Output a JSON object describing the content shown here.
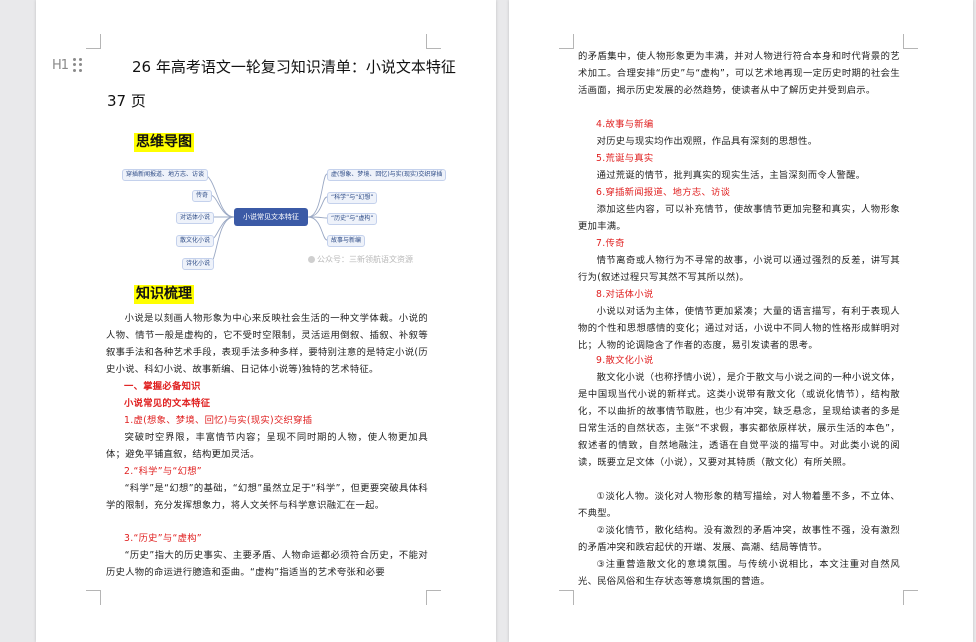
{
  "left_page": {
    "heading_tag": "H1",
    "title": "26 年高考语文一轮复习知识清单：小说文本特征",
    "title_line2": "37 页",
    "mindmap_heading": "思维导图",
    "knowledge_heading": "知识梳理",
    "mindmap": {
      "center": "小说常见文本特征",
      "left_nodes": [
        "穿插新闻报道、地方志、访谈",
        "传奇",
        "对话体小说",
        "散文化小说",
        "诗化小说"
      ],
      "right_nodes": [
        "虚(想象、梦境、回忆)与实(现实)交织穿插",
        "“科学”与“幻想”",
        "“历史”与“虚构”",
        "故事与新编"
      ],
      "watermark": "公众号：三新领航语文资源"
    },
    "paragraphs": {
      "intro": "小说是以刻画人物形象为中心来反映社会生活的一种文学体裁。小说的人物、情节一般是虚构的，它不受时空限制，灵活运用倒叙、插叙、补叙等叙事手法和各种艺术手段，表现手法多种多样，要特别注意的是特定小说(历史小说、科幻小说、故事新编、日记体小说等)独特的艺术特征。",
      "sec1": "一、掌握必备知识",
      "sec1_sub": "小说常见的文本特征",
      "item1_title": "1.虚(想象、梦境、回忆)与实(现实)交织穿插",
      "item1_body": "突破时空界限，丰富情节内容；呈现不同时期的人物，使人物更加具体；避免平铺直叙，结构更加灵活。",
      "item2_title": "2.“科学”与“幻想”",
      "item2_body": "“科学”是“幻想”的基础，“幻想”虽然立足于“科学”，但更要突破具体科学的限制，充分发挥想象力，将人文关怀与科学意识融汇在一起。",
      "item3_title": "3.“历史”与“虚构”",
      "item3_body": "“历史”指大的历史事实、主要矛盾、人物命运都必须符合历史，不能对历史人物的命运进行臆造和歪曲。“虚构”指适当的艺术夸张和必要"
    }
  },
  "right_page": {
    "p_top": "的矛盾集中，使人物形象更为丰满，并对人物进行符合本身和时代背景的艺术加工。合理安排“历史”与“虚构”，可以艺术地再现一定历史时期的社会生活画面，揭示历史发展的必然趋势，使读者从中了解历史并受到启示。",
    "item4_title": "4.故事与新编",
    "item4_body": "对历史与现实均作出观照，作品具有深刻的思想性。",
    "item5_title": "5.荒诞与真实",
    "item5_body": "通过荒诞的情节，批判真实的现实生活，主旨深刻而令人警醒。",
    "item6_title": "6.穿插新闻报道、地方志、访谈",
    "item6_body": "添加这些内容，可以补充情节，使故事情节更加完整和真实，人物形象更加丰满。",
    "item7_title": "7.传奇",
    "item7_body": "情节离奇或人物行为不寻常的故事，小说可以通过强烈的反差，讲写其行为(叙述过程只写其然不写其所以然)。",
    "item8_title": "8.对话体小说",
    "item8_body": "小说以对话为主体，使情节更加紧凑；大量的语言描写，有利于表现人物的个性和思想感情的变化；通过对话，小说中不同人物的性格形成鲜明对比；人物的论调隐含了作者的态度，易引发读者的思考。",
    "item9_title": "9.散文化小说",
    "item9_body": "散文化小说（也称抒情小说），是介于散文与小说之间的一种小说文体，是中国现当代小说的新样式。这类小说带有散文化（或说化情节），结构散化，不以曲折的故事情节取胜，也少有冲突，缺乏悬念，呈现给读者的多是日常生活的自然状态，主张“不求假，事实都依原样状，展示生活的本色”，叙述者的情致，自然地融注，透语在自觉平淡的描写中。对此类小说的阅读，既要立足文体（小说），又要对其特质（散文化）有所关照。",
    "sub1": "①淡化人物。淡化对人物形象的精写描绘，对人物着墨不多，不立体、不典型。",
    "sub2": "②淡化情节，散化结构。没有激烈的矛盾冲突，故事性不强，没有激烈的矛盾冲突和跌宕起伏的开端、发展、高潮、结局等情节。",
    "sub3": "③注重营造散文化的意境氛围。与传统小说相比，本文注重对自然风光、民俗风俗和生存状态等意境氛围的营造。"
  }
}
